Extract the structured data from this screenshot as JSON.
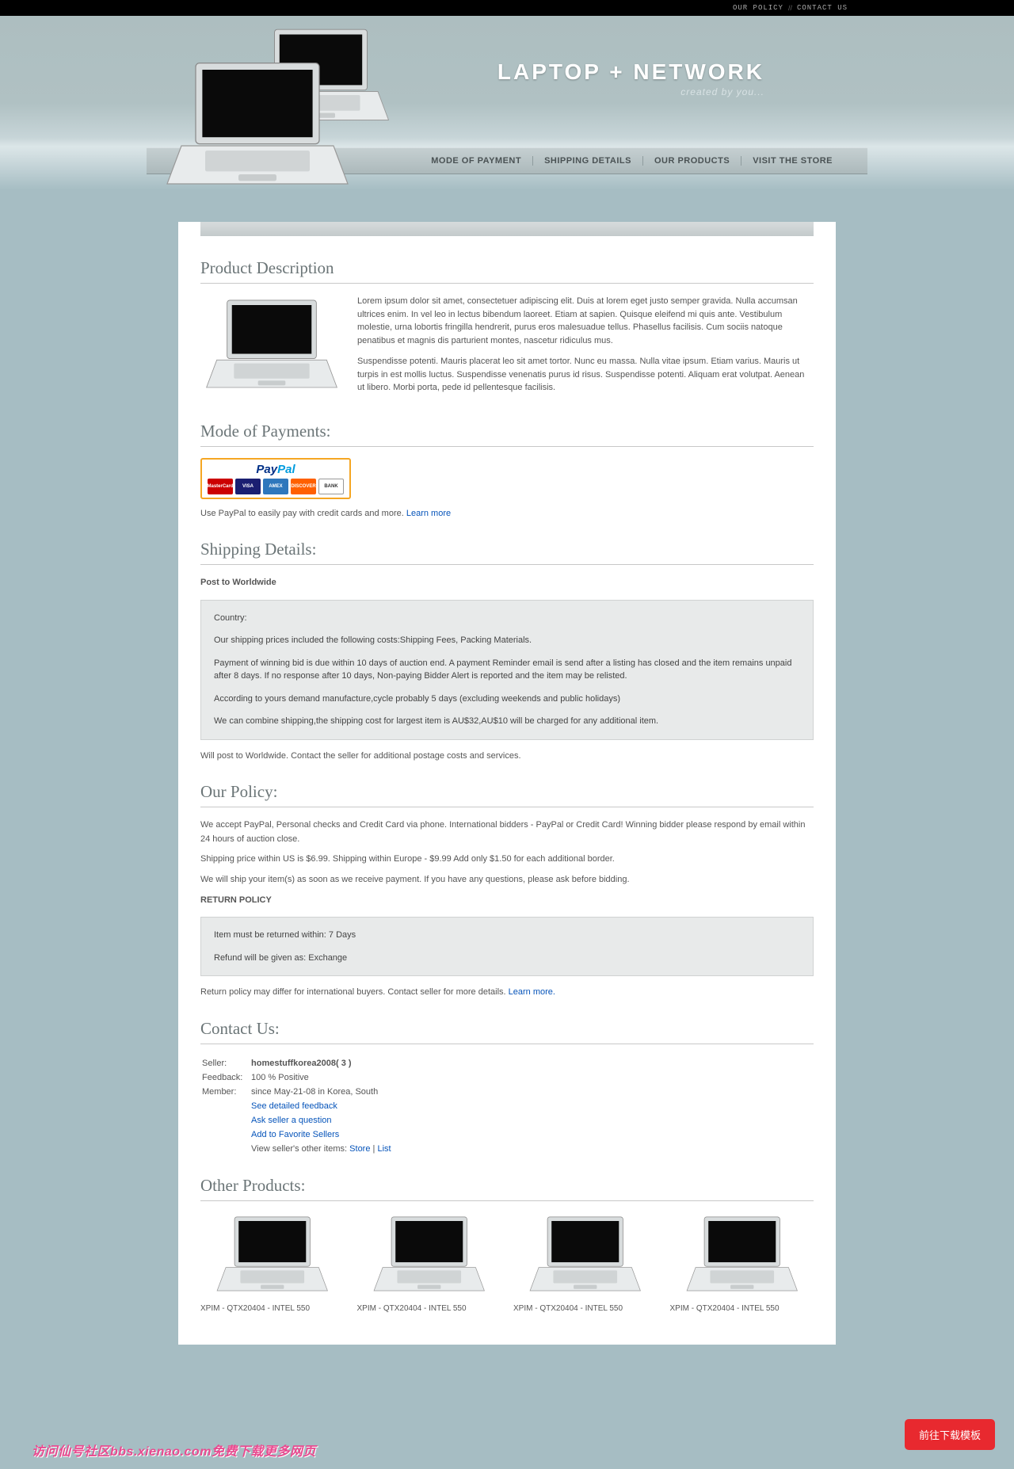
{
  "topbar": {
    "policy": "OUR POLICY",
    "sep": "//",
    "contact": "CONTACT US"
  },
  "brand": {
    "title": "LAPTOP + NETWORK",
    "tagline": "created by you..."
  },
  "nav": {
    "n1": "MODE OF PAYMENT",
    "n2": "SHIPPING DETAILS",
    "n3": "OUR PRODUCTS",
    "n4": "VISIT THE STORE"
  },
  "sections": {
    "desc_h": "Product Description",
    "desc_p1": "Lorem ipsum dolor sit amet, consectetuer adipiscing elit. Duis at lorem eget justo semper gravida. Nulla accumsan ultrices enim. In vel leo in lectus bibendum laoreet. Etiam at sapien. Quisque eleifend mi quis ante. Vestibulum molestie, urna lobortis fringilla hendrerit, purus eros malesuadue tellus. Phasellus facilisis. Cum sociis natoque penatibus et magnis dis parturient montes, nascetur ridiculus mus.",
    "desc_p2": "Suspendisse potenti. Mauris placerat leo sit amet tortor. Nunc eu massa. Nulla vitae ipsum. Etiam varius. Mauris ut turpis in est mollis luctus. Suspendisse venenatis purus id risus. Suspendisse potenti. Aliquam erat volutpat. Aenean ut libero. Morbi porta, pede id pellentesque facilisis.",
    "pay_h": "Mode of Payments:",
    "pay_text": "Use PayPal to easily pay with credit cards and more. ",
    "pay_link": "Learn more",
    "ship_h": "Shipping Details:",
    "ship_intro": "Post to Worldwide",
    "ship_b1": "Country:",
    "ship_b2": "Our shipping prices included the following costs:Shipping Fees, Packing Materials.",
    "ship_b3": "Payment of winning bid is due within 10 days of auction end. A payment Reminder email is send after a listing has closed and the item remains unpaid after 8 days. If no response after 10 days, Non-paying Bidder Alert is reported and the item may be relisted.",
    "ship_b4": "According to yours demand manufacture,cycle probably 5 days (excluding weekends and public holidays)",
    "ship_b5": "We can combine shipping,the shipping cost for largest item is AU$32,AU$10 will be charged for any additional item.",
    "ship_out": "Will post to Worldwide. Contact the seller for additional postage costs and services.",
    "policy_h": "Our Policy:",
    "policy_p1": "We accept PayPal, Personal checks and Credit Card via phone. International bidders - PayPal or Credit Card! Winning bidder please respond by email within 24 hours of auction close.",
    "policy_p2": "Shipping price within US is $6.99. Shipping within Europe - $9.99 Add only $1.50 for each additional border.",
    "policy_p3": "We will ship your item(s) as soon as we receive payment. If you have any questions, please ask before bidding.",
    "policy_rp": "RETURN POLICY",
    "policy_b1": "Item must be returned within: 7 Days",
    "policy_b2": "Refund will be given as: Exchange",
    "policy_out": "Return policy may differ for international buyers. Contact seller for more details. ",
    "policy_link": "Learn more.",
    "contact_h": "Contact Us:",
    "contact": {
      "seller_l": "Seller:",
      "seller_v": "homestuffkorea2008( 3 )",
      "feedback_l": "Feedback:",
      "feedback_v": "100 % Positive",
      "member_l": "Member:",
      "member_v": "since May-21-08 in Korea, South",
      "l1": "See detailed feedback",
      "l2": "Ask seller a question",
      "l3": "Add to Favorite Sellers",
      "l4_pre": "View seller's other items: ",
      "l4_a": "Store",
      "l4_sep": " | ",
      "l4_b": "List"
    },
    "other_h": "Other Products:",
    "products": [
      {
        "name": "XPIM - QTX20404 - INTEL 550"
      },
      {
        "name": "XPIM - QTX20404 - INTEL 550"
      },
      {
        "name": "XPIM - QTX20404 - INTEL 550"
      },
      {
        "name": "XPIM - QTX20404 - INTEL 550"
      }
    ]
  },
  "cards": {
    "mc": "MasterCard",
    "visa": "VISA",
    "amex": "AMEX",
    "disc": "DISCOVER",
    "bank": "BANK"
  },
  "paypal": {
    "p1": "Pay",
    "p2": "Pal"
  },
  "btn": "前往下载模板",
  "watermark": "访问仙号社区bbs.xienao.com免费下载更多网页"
}
